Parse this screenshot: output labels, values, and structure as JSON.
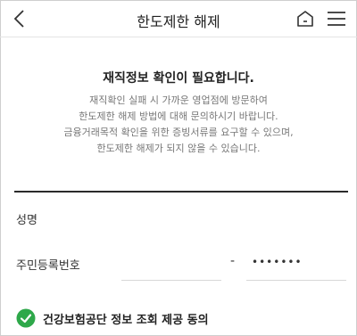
{
  "header": {
    "title": "한도제한 해제",
    "back_icon": "chevron-left-icon",
    "home_icon": "home-icon",
    "menu_icon": "hamburger-menu-icon"
  },
  "notice": {
    "title": "재직정보 확인이 필요합니다.",
    "lines": [
      "재직확인 실패 시 가까운 영업점에 방문하여",
      "한도제한 해제 방법에 대해 문의하시기 바랍니다.",
      "금융거래목적 확인을 위한 증빙서류를 요구할 수 있으며,",
      "한도제한 해제가 되지 않을 수 있습니다."
    ]
  },
  "form": {
    "name_label": "성명",
    "rrn_label": "주민등록번호",
    "rrn_front_value": "",
    "rrn_separator": "-",
    "rrn_back_value": "•••••••"
  },
  "consent": {
    "label": "건강보험공단 정보 조회 제공 동의",
    "checked": true,
    "check_color": "#2ea84a"
  }
}
